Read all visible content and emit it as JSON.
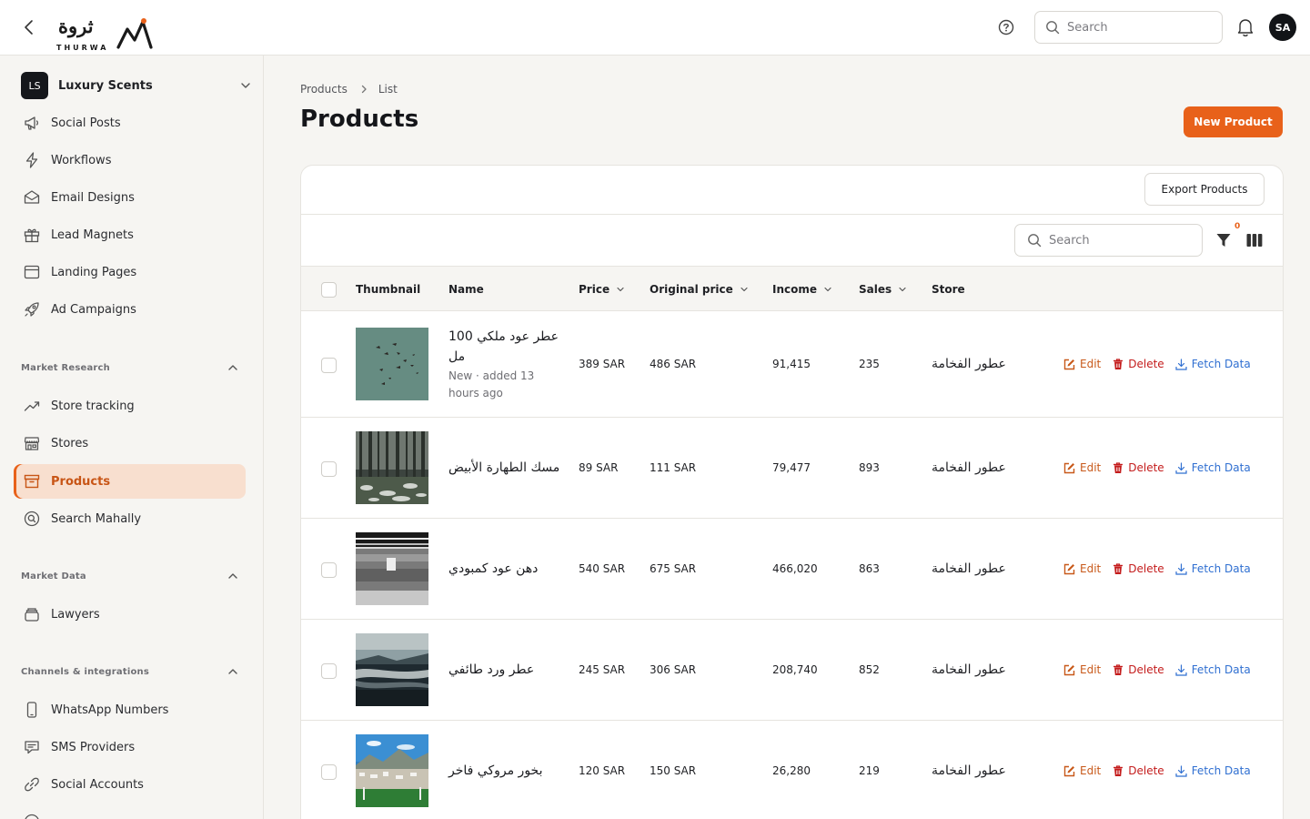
{
  "app": {
    "logo_ar": "ثروة",
    "logo_en": "THURWA"
  },
  "topbar": {
    "search_placeholder": "Search",
    "avatar_initials": "SA"
  },
  "sidebar": {
    "workspace": {
      "initials": "LS",
      "name": "Luxury Scents"
    },
    "items": [
      {
        "label": "Social Posts",
        "icon": "megaphone-icon"
      },
      {
        "label": "Workflows",
        "icon": "lightning-icon"
      },
      {
        "label": "Email Designs",
        "icon": "envelope-icon"
      },
      {
        "label": "Lead Magnets",
        "icon": "gift-icon"
      },
      {
        "label": "Landing Pages",
        "icon": "browser-icon"
      },
      {
        "label": "Ad Campaigns",
        "icon": "rocket-icon"
      }
    ],
    "sections": [
      {
        "title": "Market Research",
        "items": [
          {
            "label": "Store tracking",
            "icon": "trend-icon"
          },
          {
            "label": "Stores",
            "icon": "storefront-icon"
          },
          {
            "label": "Products",
            "icon": "archive-box-icon",
            "active": true
          },
          {
            "label": "Search Mahally",
            "icon": "search-circle-icon"
          }
        ]
      },
      {
        "title": "Market Data",
        "items": [
          {
            "label": "Lawyers",
            "icon": "layers-icon"
          }
        ]
      },
      {
        "title": "Channels & integrations",
        "items": [
          {
            "label": "WhatsApp Numbers",
            "icon": "phone-icon"
          },
          {
            "label": "SMS Providers",
            "icon": "chat-bubble-icon"
          },
          {
            "label": "Social Accounts",
            "icon": "link-icon"
          }
        ]
      }
    ]
  },
  "breadcrumb": {
    "items": [
      "Products",
      "List"
    ]
  },
  "page": {
    "title": "Products",
    "new_button": "New Product",
    "export_button": "Export Products"
  },
  "table": {
    "search_placeholder": "Search",
    "filter_count": "0",
    "columns": {
      "thumbnail": "Thumbnail",
      "name": "Name",
      "price": "Price",
      "original_price": "Original price",
      "income": "Income",
      "sales": "Sales",
      "store": "Store"
    },
    "actions": {
      "edit": "Edit",
      "delete": "Delete",
      "fetch": "Fetch Data"
    },
    "rows": [
      {
        "name": "عطر عود ملكي 100 مل",
        "subtitle": "New · added 13 hours ago",
        "price": "389 SAR",
        "original_price": "486 SAR",
        "income": "91,415",
        "sales": "235",
        "store": "عطور الفخامة"
      },
      {
        "name": "مسك الطهارة الأبيض",
        "subtitle": "",
        "price": "89 SAR",
        "original_price": "111 SAR",
        "income": "79,477",
        "sales": "893",
        "store": "عطور الفخامة"
      },
      {
        "name": "دهن عود كمبودي",
        "subtitle": "",
        "price": "540 SAR",
        "original_price": "675 SAR",
        "income": "466,020",
        "sales": "863",
        "store": "عطور الفخامة"
      },
      {
        "name": "عطر ورد طائفي",
        "subtitle": "",
        "price": "245 SAR",
        "original_price": "306 SAR",
        "income": "208,740",
        "sales": "852",
        "store": "عطور الفخامة"
      },
      {
        "name": "بخور مروكي فاخر",
        "subtitle": "",
        "price": "120 SAR",
        "original_price": "150 SAR",
        "income": "26,280",
        "sales": "219",
        "store": "عطور الفخامة"
      }
    ]
  }
}
